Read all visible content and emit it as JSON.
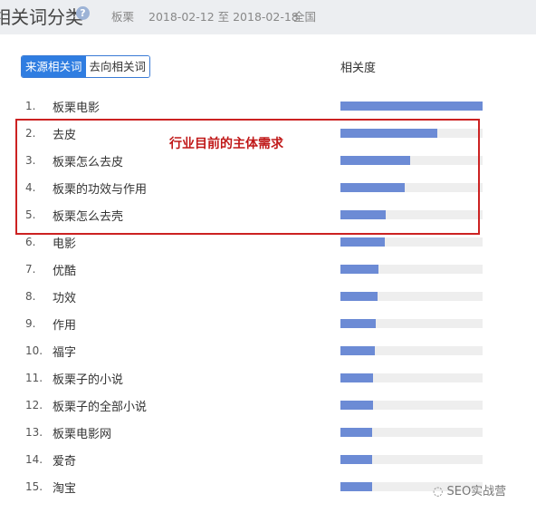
{
  "header": {
    "title": "相关词分类",
    "keyword": "板栗",
    "date_range": "2018-02-12 至 2018-02-18",
    "region": "全国",
    "help_icon": "question-circle-icon"
  },
  "tabs": [
    {
      "label": "来源相关词",
      "active": true
    },
    {
      "label": "去向相关词",
      "active": false
    }
  ],
  "column_header": "相关度",
  "annotation": "行业目前的主体需求",
  "watermark": "SEO实战营",
  "colors": {
    "bar": "#6c8bd5",
    "track": "#eeeeee",
    "highlight": "#cc2222",
    "tab_active": "#2f7de1"
  },
  "rows": [
    {
      "rank": "1.",
      "keyword": "板栗电影",
      "relevance": 100
    },
    {
      "rank": "2.",
      "keyword": "去皮",
      "relevance": 68
    },
    {
      "rank": "3.",
      "keyword": "板栗怎么去皮",
      "relevance": 49
    },
    {
      "rank": "4.",
      "keyword": "板栗的功效与作用",
      "relevance": 45
    },
    {
      "rank": "5.",
      "keyword": "板栗怎么去壳",
      "relevance": 32
    },
    {
      "rank": "6.",
      "keyword": "电影",
      "relevance": 31
    },
    {
      "rank": "7.",
      "keyword": "优酷",
      "relevance": 27
    },
    {
      "rank": "8.",
      "keyword": "功效",
      "relevance": 26
    },
    {
      "rank": "9.",
      "keyword": "作用",
      "relevance": 25
    },
    {
      "rank": "10.",
      "keyword": "福字",
      "relevance": 24
    },
    {
      "rank": "11.",
      "keyword": "板栗子的小说",
      "relevance": 23
    },
    {
      "rank": "12.",
      "keyword": "板栗子的全部小说",
      "relevance": 23
    },
    {
      "rank": "13.",
      "keyword": "板栗电影网",
      "relevance": 22
    },
    {
      "rank": "14.",
      "keyword": "爱奇",
      "relevance": 22
    },
    {
      "rank": "15.",
      "keyword": "淘宝",
      "relevance": 22
    }
  ]
}
